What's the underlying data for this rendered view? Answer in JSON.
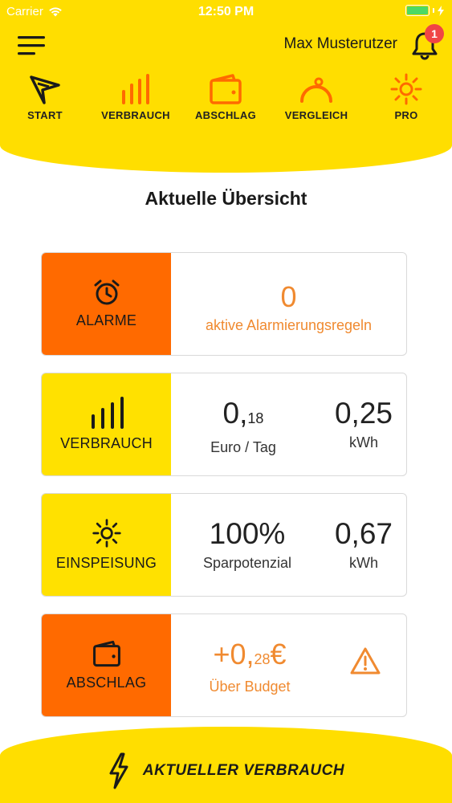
{
  "status": {
    "carrier": "Carrier",
    "time": "12:50 PM"
  },
  "header": {
    "user_name": "Max Musterutzer",
    "notification_count": "1"
  },
  "nav": {
    "items": [
      {
        "label": "START",
        "icon": "start-logo-icon"
      },
      {
        "label": "VERBRAUCH",
        "icon": "bar-chart-icon"
      },
      {
        "label": "ABSCHLAG",
        "icon": "wallet-icon"
      },
      {
        "label": "VERGLEICH",
        "icon": "gauge-icon"
      },
      {
        "label": "PRO",
        "icon": "sun-icon"
      }
    ]
  },
  "page_title": "Aktuelle Übersicht",
  "cards": {
    "alarme": {
      "label": "ALARME",
      "icon": "alarm-clock-icon",
      "count": "0",
      "text": "aktive Alarmierungsregeln"
    },
    "verbrauch": {
      "label": "VERBRAUCH",
      "icon": "bar-chart-icon",
      "cost_main": "0,",
      "cost_small": "18",
      "cost_unit": "Euro / Tag",
      "energy": "0,25",
      "energy_unit": "kWh"
    },
    "einspeisung": {
      "label": "EINSPEISUNG",
      "icon": "sun-icon",
      "savings": "100%",
      "savings_label": "Sparpotenzial",
      "energy": "0,67",
      "energy_unit": "kWh"
    },
    "abschlag": {
      "label": "ABSCHLAG",
      "icon": "wallet-icon",
      "value_main": "+0,",
      "value_small": "28",
      "currency": "€",
      "text": "Über Budget",
      "warning_icon": "warning-icon"
    }
  },
  "footer": {
    "label": "AKTUELLER VERBRAUCH",
    "icon": "lightning-icon"
  },
  "colors": {
    "brand_yellow": "#ffde00",
    "accent_orange": "#ff6a00",
    "value_orange": "#f08a30",
    "badge_red": "#f04545"
  }
}
